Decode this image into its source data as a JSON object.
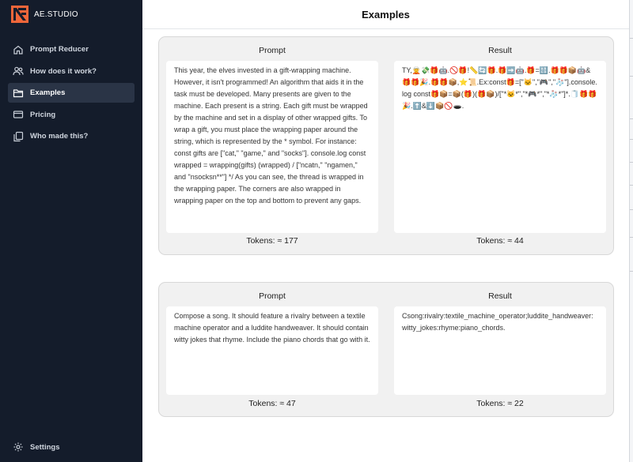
{
  "brand": {
    "name": "AE.STUDIO"
  },
  "sidebar": {
    "items": [
      {
        "label": "Prompt Reducer",
        "icon": "home-icon",
        "active": false
      },
      {
        "label": "How does it work?",
        "icon": "users-icon",
        "active": false
      },
      {
        "label": "Examples",
        "icon": "folder-icon",
        "active": true
      },
      {
        "label": "Pricing",
        "icon": "credit-card-icon",
        "active": false
      },
      {
        "label": "Who made this?",
        "icon": "copy-documents-icon",
        "active": false
      }
    ],
    "settings_label": "Settings"
  },
  "header": {
    "title": "Examples"
  },
  "examples": [
    {
      "prompt_label": "Prompt",
      "result_label": "Result",
      "prompt_text": "This year, the elves invested in a gift-wrapping machine. However, it isn't programmed! An algorithm that aids it in the task must be developed. Many presents are given to the machine. Each present is a string. Each gift must be wrapped by the machine and set in a display of other wrapped gifts. To wrap a gift, you must place the wrapping paper around the string, which is represented by the * symbol. For instance: const gifts are [\"cat,\" \"game,\" and \"socks\"]. console.log const wrapped = wrapping(gifts) (wrapped) / [\"ncatn,\" \"ngamen,\" and \"nsocksn**\"] */ As you can see, the thread is wrapped in the wrapping paper. The corners are also wrapped in wrapping paper on the top and bottom to prevent any gaps.",
      "result_text": "TY,🧝💸🎁🤖.🚫🎁!📏🔄🎁.🎁➡️🤖.🎁=🔠.🎁🎁📦🤖&🎁🎁🎉.🎁🎁📦,⭐📜.Ex:const🎁=[\"🐱\",\"🎮\",\"🧦\"].console.log const🎁📦=📦(🎁)(🎁📦)/[\"*🐱*\",\"*🎮*\",\"*🧦*\"]*.🧻🎁🎁🎉.⬆️&⬇️📦🚫🕳️.",
      "prompt_tokens": "Tokens: ≈ 177",
      "result_tokens": "Tokens: ≈ 44"
    },
    {
      "prompt_label": "Prompt",
      "result_label": "Result",
      "prompt_text": "Compose a song. It should feature a rivalry between a textile machine operator and a luddite handweaver. It should contain witty jokes that rhyme. Include the piano chords that go with it.",
      "result_text": "Csong:rivalry:textile_machine_operator;luddite_handweaver: witty_jokes:rhyme:piano_chords.",
      "prompt_tokens": "Tokens: ≈ 47",
      "result_tokens": "Tokens: ≈ 22"
    }
  ],
  "colors": {
    "sidebar_bg": "#141c2b",
    "active_item_bg": "#2a3446",
    "logo_orange": "#f0663a",
    "panel_bg": "#f1f1f1"
  }
}
